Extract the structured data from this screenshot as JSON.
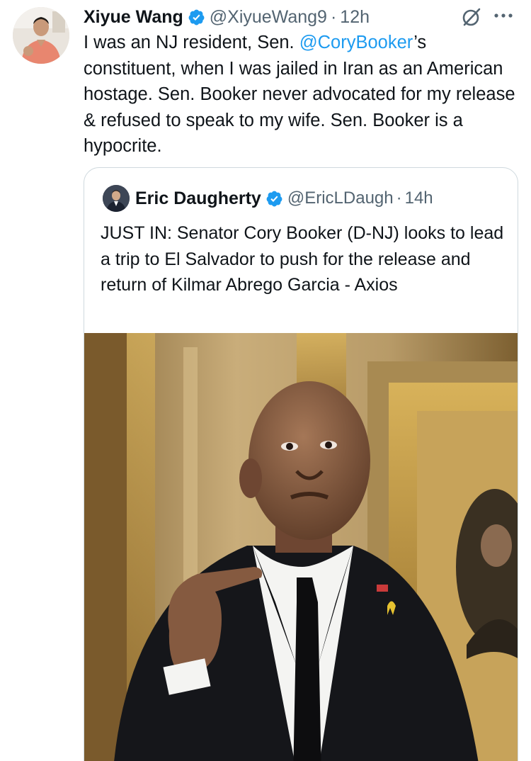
{
  "tweet": {
    "author_name": "Xiyue Wang",
    "author_handle": "@XiyueWang9",
    "separator": "·",
    "timestamp": "12h",
    "text_part1": "I was an NJ resident, Sen. ",
    "mention": "@CoryBooker",
    "text_part2": "’s constituent, when I was jailed in Iran as an American hostage. Sen. Booker never advocated for my release & refused to speak to my wife. Sen. Booker is a hypocrite."
  },
  "quoted_tweet": {
    "author_name": "Eric Daugherty",
    "author_handle": "@EricLDaugh",
    "separator": "·",
    "timestamp": "14h",
    "text": "JUST IN: Senator Cory Booker (D-NJ) looks to lead a trip to El Salvador to push for the release and return of Kilmar Abrego Garcia - Axios"
  },
  "icons": {
    "verified": "verified-badge-icon",
    "grok": "grok-icon",
    "more": "more-options-icon"
  },
  "colors": {
    "text": "#0f1419",
    "secondary": "#536471",
    "link": "#1d9bf0",
    "verified": "#1d9bf0",
    "border": "#cfd9de"
  }
}
